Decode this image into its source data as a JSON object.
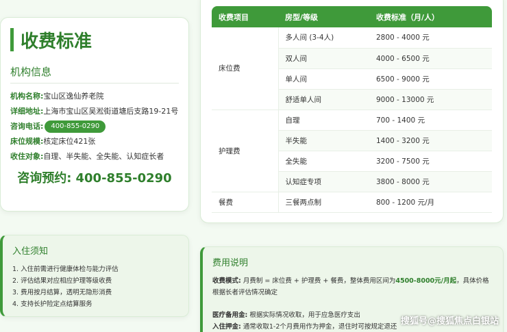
{
  "info": {
    "title": "收费标准",
    "subtitle": "机构信息",
    "rows": [
      {
        "k": "机构名称:",
        "v": "宝山区逸仙养老院"
      },
      {
        "k": "详细地址:",
        "v": "上海市宝山区吴淞街道塘后支路19-21号"
      },
      {
        "k": "咨询电话:",
        "v": "400-855-0290"
      },
      {
        "k": "床位规模:",
        "v": "核定床位421张"
      },
      {
        "k": "收住对象:",
        "v": "自理、半失能、全失能、认知症长者"
      }
    ],
    "big_label": "咨询预约:",
    "big_number": "400-855-0290"
  },
  "table": {
    "headers": [
      "收费项目",
      "房型/等级",
      "收费标准（月/人）"
    ],
    "groups": [
      {
        "name": "床位费",
        "rows": [
          {
            "level": "多人间 (3-4人)",
            "price": "2800 - 4000 元"
          },
          {
            "level": "双人间",
            "price": "4000 - 6500 元"
          },
          {
            "level": "单人间",
            "price": "6500 - 9000 元"
          },
          {
            "level": "舒适单人间",
            "price": "9000 - 13000 元"
          }
        ]
      },
      {
        "name": "护理费",
        "rows": [
          {
            "level": "自理",
            "price": "700 - 1400 元"
          },
          {
            "level": "半失能",
            "price": "1400 - 3200 元"
          },
          {
            "level": "全失能",
            "price": "3200 - 7500 元"
          },
          {
            "level": "认知症专项",
            "price": "3800 - 8000 元"
          }
        ]
      },
      {
        "name": "餐费",
        "rows": [
          {
            "level": "三餐两点制",
            "price": "800 - 1200 元/月"
          }
        ]
      }
    ]
  },
  "notes": {
    "title": "入住须知",
    "lines": [
      "1. 入住前需进行健康体检与能力评估",
      "2. 评估结果对应相应护理等级收费",
      "3. 费用按月结算，透明无隐形消费",
      "4. 支持长护险定点结算服务"
    ]
  },
  "explain": {
    "title": "费用说明",
    "mode_label": "收费模式:",
    "mode_text": "月费制 = 床位费 + 护理费 + 餐费，整体费用区间为",
    "mode_range": "4500-8000元/月起",
    "mode_tail": "，具体价格根据长者评估情况确定",
    "medical_label": "医疗备用金:",
    "medical_text": "根据实际情况收取，用于应急医疗支出",
    "deposit_label": "入住押金:",
    "deposit_text": "通常收取1-2个月费用作为押金，退住时可按规定退还"
  },
  "watermark": "搜狐号@搜狐焦点白银站"
}
